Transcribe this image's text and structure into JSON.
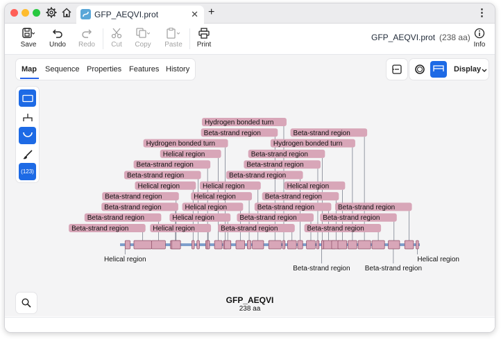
{
  "tab": {
    "title": "GFP_AEQVI.prot",
    "close": "✕"
  },
  "titlebar": {
    "new_tab": "+",
    "menu": "⋮"
  },
  "toolbar": {
    "save": "Save",
    "undo": "Undo",
    "redo": "Redo",
    "cut": "Cut",
    "copy": "Copy",
    "paste": "Paste",
    "print": "Print",
    "info": "Info",
    "filename": "GFP_AEQVI.prot",
    "length": "(238 aa)"
  },
  "view_tabs": [
    "Map",
    "Sequence",
    "Properties",
    "Features",
    "History"
  ],
  "display": {
    "label": "Display"
  },
  "tools": {
    "number_label": "(123)"
  },
  "map": {
    "name": "GFP_AEQVI",
    "length": 238,
    "length_label": "238 aa",
    "feature_color": "#d8a6b8",
    "backbone_color": "#7e9fcc",
    "features": [
      {
        "label": "Helical region",
        "start": 4,
        "end": 8,
        "below": true
      },
      {
        "label": "Beta-strand region",
        "start": 11,
        "end": 25
      },
      {
        "label": "Beta-strand region",
        "start": 25,
        "end": 36
      },
      {
        "label": "Beta-strand region",
        "start": 40,
        "end": 48
      },
      {
        "label": "Beta-strand region",
        "start": 41,
        "end": 48
      },
      {
        "label": "Helical region",
        "start": 57,
        "end": 59
      },
      {
        "label": "Beta-strand region",
        "start": 61,
        "end": 63
      },
      {
        "label": "Beta-strand region",
        "start": 68,
        "end": 71
      },
      {
        "label": "Helical region",
        "start": 69,
        "end": 71
      },
      {
        "label": "Helical region",
        "start": 75,
        "end": 81
      },
      {
        "label": "Hydrogen bonded turn",
        "start": 82,
        "end": 85
      },
      {
        "label": "Helical region",
        "start": 83,
        "end": 88
      },
      {
        "label": "Helical region",
        "start": 92,
        "end": 99
      },
      {
        "label": "Helical region",
        "start": 101,
        "end": 104
      },
      {
        "label": "Helical region",
        "start": 105,
        "end": 114
      },
      {
        "label": "Beta-strand region",
        "start": 118,
        "end": 128
      },
      {
        "label": "Hydrogen bonded turn",
        "start": 129,
        "end": 131
      },
      {
        "label": "Beta-strand region",
        "start": 133,
        "end": 140
      },
      {
        "label": "Beta-strand region",
        "start": 141,
        "end": 145
      },
      {
        "label": "Beta-strand region",
        "start": 148,
        "end": 155
      },
      {
        "label": "Beta-strand region",
        "start": 156,
        "end": 158
      },
      {
        "label": "Beta-strand region",
        "start": 160,
        "end": 171
      },
      {
        "label": "Beta-strand region",
        "start": 160,
        "end": 161
      },
      {
        "label": "Beta-strand region",
        "start": 168,
        "end": 175
      },
      {
        "label": "Helical region",
        "start": 173,
        "end": 180
      },
      {
        "label": "Hydrogen bonded turn",
        "start": 181,
        "end": 188
      },
      {
        "label": "Beta-strand region",
        "start": 189,
        "end": 199
      },
      {
        "label": "Beta-strand region",
        "start": 200,
        "end": 210
      },
      {
        "label": "Beta-strand region",
        "start": 213,
        "end": 222
      },
      {
        "label": "Beta-strand region",
        "start": 226,
        "end": 233
      },
      {
        "label": "Helical region",
        "start": 235,
        "end": 237,
        "below": true
      }
    ],
    "below_labels": [
      {
        "label": "Helical region"
      },
      {
        "label": "Beta-strand region"
      },
      {
        "label": "Beta-strand region"
      },
      {
        "label": "Helical region"
      }
    ]
  }
}
